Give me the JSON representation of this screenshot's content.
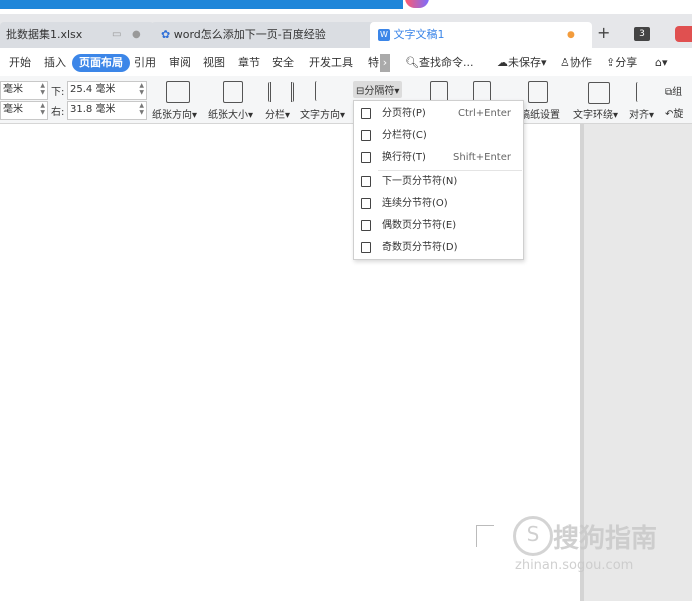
{
  "tabs": [
    {
      "title": "批数据集1.xlsx"
    },
    {
      "title": "word怎么添加下一页-百度经验"
    },
    {
      "title": "文字文稿1"
    }
  ],
  "tab_count": "3",
  "menu": [
    "开始",
    "插入",
    "页面布局",
    "引用",
    "审阅",
    "视图",
    "章节",
    "安全",
    "开发工具",
    "特"
  ],
  "search_label": "查找命令...",
  "right_actions": {
    "unsaved": "未保存",
    "collab": "协作",
    "share": "分享"
  },
  "ribbon": {
    "margins": {
      "top_val": "毫米",
      "bottom_label": "下:",
      "bottom_val": "25.4 毫米",
      "left_val": "毫米",
      "right_label": "右:",
      "right_val": "31.8 毫米"
    },
    "orientation": "纸张方向",
    "size": "纸张大小",
    "columns": "分栏",
    "text_direction": "文字方向",
    "breaks": "分隔符",
    "background": "稿纸设置",
    "wrap": "文字环绕",
    "align": "对齐",
    "group": "组",
    "rotate": "旋"
  },
  "dropdown": {
    "items": [
      {
        "label": "分页符(P)",
        "shortcut": "Ctrl+Enter"
      },
      {
        "label": "分栏符(C)",
        "shortcut": ""
      },
      {
        "label": "换行符(T)",
        "shortcut": "Shift+Enter"
      },
      {
        "label": "下一页分节符(N)",
        "shortcut": ""
      },
      {
        "label": "连续分节符(O)",
        "shortcut": ""
      },
      {
        "label": "偶数页分节符(E)",
        "shortcut": ""
      },
      {
        "label": "奇数页分节符(D)",
        "shortcut": ""
      }
    ]
  },
  "watermark": {
    "brand": "搜狗指南",
    "url": "zhinan.sogou.com"
  },
  "colors": {
    "accent": "#3c86e8",
    "tabbar": "#e6e7ea",
    "topblue": "#1f86d9",
    "login": "#e05050"
  }
}
